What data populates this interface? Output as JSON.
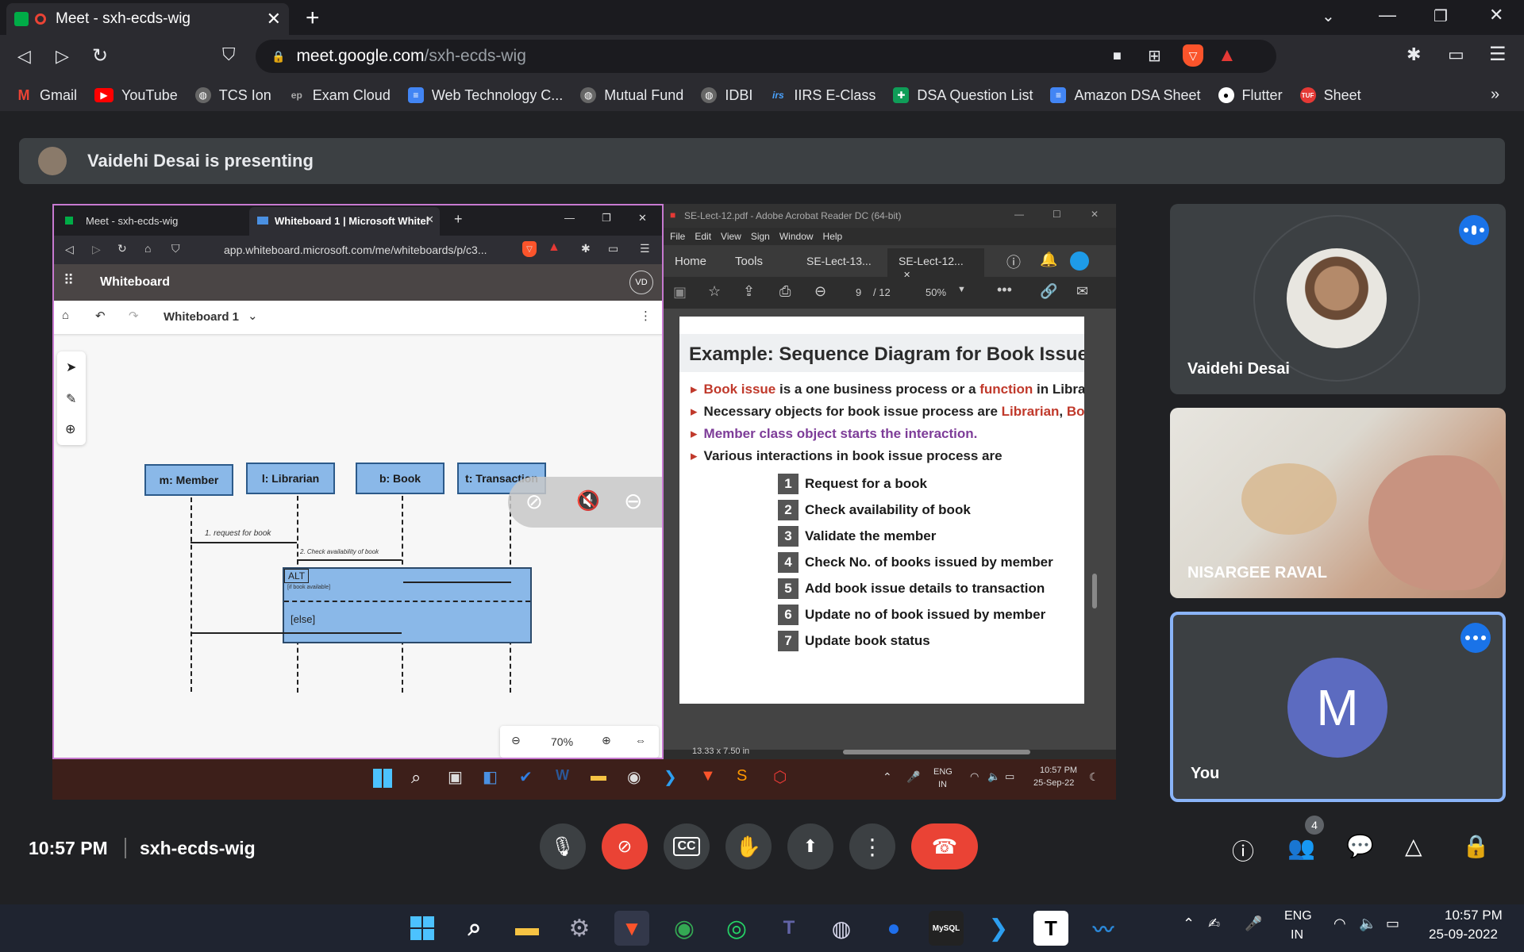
{
  "browser": {
    "tab_title": "Meet - sxh-ecds-wig",
    "url_domain": "meet.google.com",
    "url_path": "/sxh-ecds-wig",
    "bookmarks": [
      "Gmail",
      "YouTube",
      "TCS Ion",
      "Exam Cloud",
      "Web Technology C...",
      "Mutual Fund",
      "IDBI",
      "IIRS E-Class",
      "DSA Question List",
      "Amazon DSA Sheet",
      "Flutter",
      "Sheet"
    ],
    "more": "»"
  },
  "meet": {
    "presenting": "Vaidehi Desai is presenting",
    "participants": [
      {
        "name": "Vaidehi Desai"
      },
      {
        "name": "NISARGEE RAVAL"
      },
      {
        "name": "You",
        "initial": "M"
      }
    ],
    "time": "10:57 PM",
    "meeting_code": "sxh-ecds-wig",
    "people_count": "4",
    "colors": {
      "accent": "#1a73e8",
      "hangup": "#ea4335",
      "you_avatar": "#5c6bc0"
    }
  },
  "shared": {
    "inner_tab1": "Meet - sxh-ecds-wig",
    "inner_tab2": "Whiteboard 1 | Microsoft Whitel",
    "inner_url": "app.whiteboard.microsoft.com/me/whiteboards/p/c3...",
    "wb_app": "Whiteboard",
    "wb_initials": "VD",
    "wb_name": "Whiteboard 1",
    "lifelines": [
      "m: Member",
      "l: Librarian",
      "b: Book",
      "t: Transaction"
    ],
    "msg1": "1. request for book",
    "msg2": "2. Check availability of book",
    "alt": "ALT",
    "alt_guard": "[if book available]",
    "else": "[else]",
    "zoom": "70%",
    "acro_title": "SE-Lect-12.pdf - Adobe Acrobat Reader DC (64-bit)",
    "acro_menu": [
      "File",
      "Edit",
      "View",
      "Sign",
      "Window",
      "Help"
    ],
    "acro_home": "Home",
    "acro_tools": "Tools",
    "acro_tab1": "SE-Lect-13...",
    "acro_tab2": "SE-Lect-12...",
    "page_num": "9",
    "page_total": "/ 12",
    "acro_zoom": "50%",
    "slide_title": "Example: Sequence Diagram for Book Issue",
    "b1_red1": "Book issue",
    "b1_mid": " is a one business process or a ",
    "b1_red2": "function",
    "b1_end": " in Library M",
    "b2_start": "Necessary objects for book issue process are ",
    "b2_red1": "Librarian",
    "b2_sep": ", ",
    "b2_red2": "Book",
    "b2_end": ",",
    "b3": "Member class object starts the interaction.",
    "b4": "Various interactions in book issue process are",
    "steps": [
      {
        "n": "1",
        "t": "Request for a book"
      },
      {
        "n": "2",
        "t": "Check availability of book"
      },
      {
        "n": "3",
        "t": "Validate the member"
      },
      {
        "n": "4",
        "t": "Check No. of books issued by member"
      },
      {
        "n": "5",
        "t": "Add book issue details to transaction"
      },
      {
        "n": "6",
        "t": "Update no of book issued by member"
      },
      {
        "n": "7",
        "t": "Update book status"
      }
    ],
    "page_size": "13.33 x 7.50 in",
    "inner_lang1": "ENG",
    "inner_lang2": "IN",
    "inner_time": "10:57 PM",
    "inner_date": "25-Sep-22"
  },
  "taskbar": {
    "lang1": "ENG",
    "lang2": "IN",
    "time": "10:57 PM",
    "date": "25-09-2022"
  }
}
